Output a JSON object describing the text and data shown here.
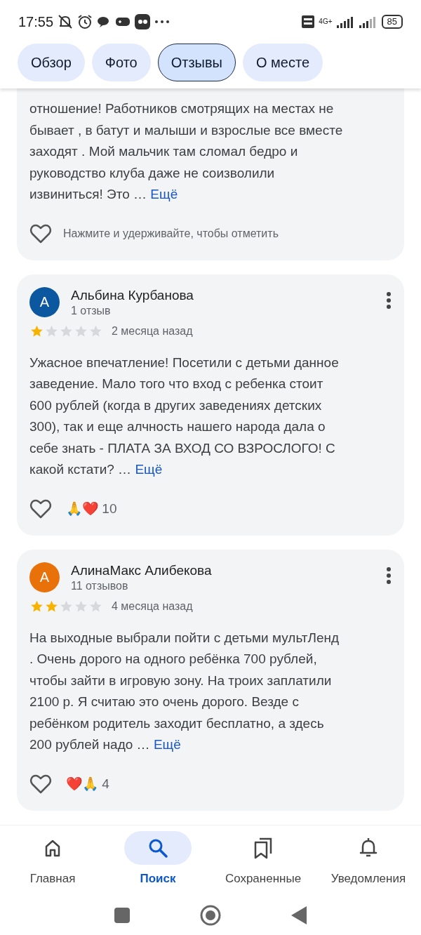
{
  "status_bar": {
    "time": "17:55",
    "network": "4G+",
    "battery": "85"
  },
  "tabs": [
    {
      "label": "Обзор",
      "selected": false
    },
    {
      "label": "Фото",
      "selected": false
    },
    {
      "label": "Отзывы",
      "selected": true
    },
    {
      "label": "О месте",
      "selected": false
    }
  ],
  "reviews": [
    {
      "text_lines": [
        "отношение! Работников смотрящих на местах не",
        "бывает , в батут и малыши и взрослые все вместе",
        "заходят . Мой мальчик там сломал бедро и",
        "руководство клуба даже не соизволили",
        "извиниться! Это …"
      ],
      "more": "Ещё",
      "like_hint": "Нажмите и удерживайте, чтобы отметить"
    },
    {
      "author": "Альбина Курбанова",
      "initial": "А",
      "color": "#0b57a0",
      "review_count": "1 отзыв",
      "stars": 1,
      "date": "2 месяца назад",
      "text_lines": [
        "Ужасное впечатление! Посетили с детьми данное",
        "заведение. Мало того что вход с ребенка стоит",
        "600 рублей (когда в других заведениях детских",
        "300), так и еще алчность нашего народа дала о",
        "себе знать - ПЛАТА ЗА ВХОД СО ВЗРОСЛОГО! С",
        "какой кстати? …"
      ],
      "more": "Ещё",
      "reactions": "🙏❤️",
      "reaction_count": "10"
    },
    {
      "author": "АлинаМакс Алибекова",
      "initial": "А",
      "color": "#e8710a",
      "review_count": "11 отзывов",
      "stars": 2,
      "date": "4 месяца назад",
      "text_lines": [
        "На выходные выбрали пойти с детьми мультЛенд",
        ". Очень дорого на одного ребёнка 700 рублей,",
        "чтобы зайти в игровую зону. На троих заплатили",
        "2100 р. Я считаю это очень дорого. Везде с",
        "ребёнком родитель заходит бесплатно, а здесь",
        "200 рублей надо …"
      ],
      "more": "Ещё",
      "reactions": "❤️🙏",
      "reaction_count": "4"
    }
  ],
  "bottom_nav": [
    {
      "kind": "home",
      "label": "Главная",
      "selected": false
    },
    {
      "kind": "search",
      "label": "Поиск",
      "selected": true
    },
    {
      "kind": "saved",
      "label": "Сохраненные",
      "selected": false
    },
    {
      "kind": "bell",
      "label": "Уведомления",
      "selected": false
    }
  ]
}
